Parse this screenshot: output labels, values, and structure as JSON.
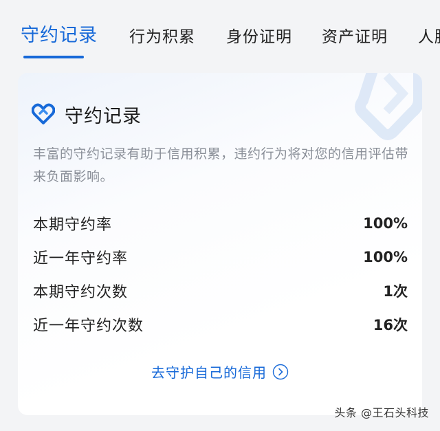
{
  "tabs": [
    {
      "label": "守约记录",
      "active": true
    },
    {
      "label": "行为积累",
      "active": false
    },
    {
      "label": "身份证明",
      "active": false
    },
    {
      "label": "资产证明",
      "active": false
    },
    {
      "label": "人脉",
      "active": false
    }
  ],
  "card": {
    "icon": "heart-link-icon",
    "title": "守约记录",
    "description": "丰富的守约记录有助于信用积累，违约行为将对您的信用评估带来负面影响。",
    "stats": [
      {
        "label": "本期守约率",
        "value": "100%"
      },
      {
        "label": "近一年守约率",
        "value": "100%"
      },
      {
        "label": "本期守约次数",
        "value": "1次"
      },
      {
        "label": "近一年守约次数",
        "value": "16次"
      }
    ],
    "link_label": "去守护自己的信用",
    "link_icon": "chevron-right-circle-icon"
  },
  "watermark": "头条 @王石头科技",
  "colors": {
    "accent": "#1769d8",
    "background": "#f3f4f6",
    "card": "#ffffff",
    "muted_text": "#8a8f98"
  }
}
